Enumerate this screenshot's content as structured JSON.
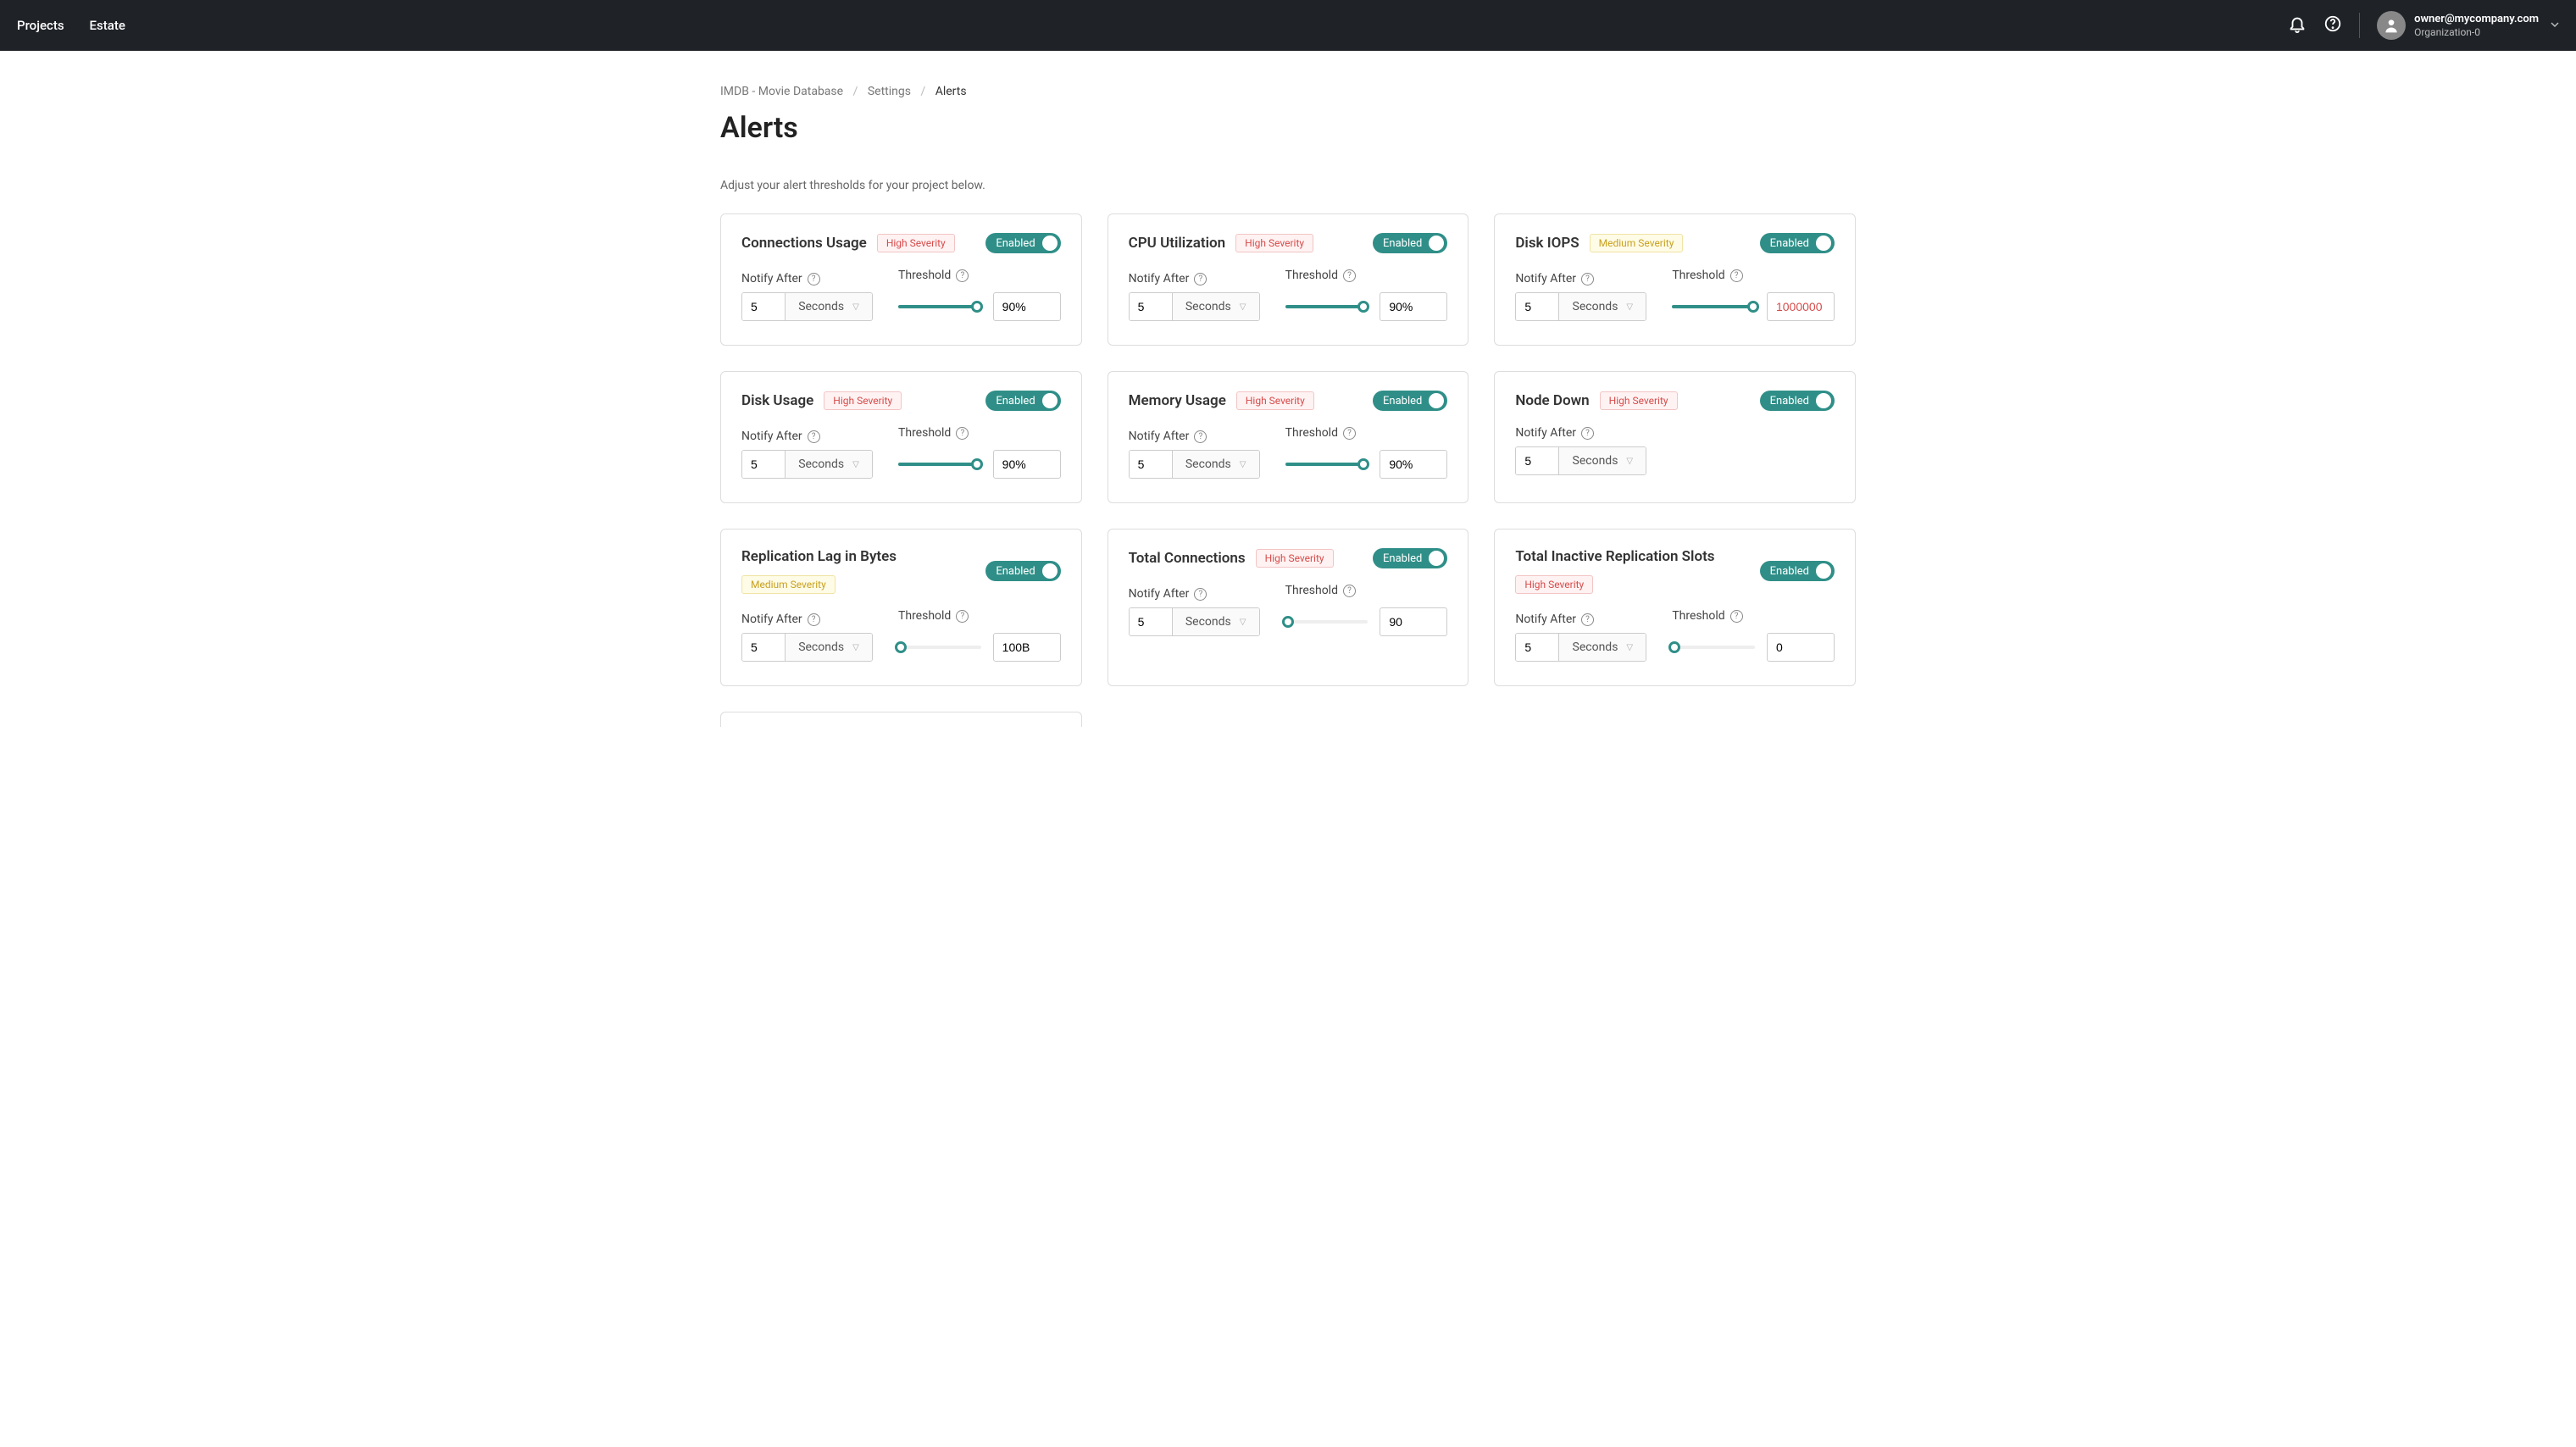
{
  "topbar": {
    "projects_label": "Projects",
    "estate_label": "Estate",
    "account_email": "owner@mycompany.com",
    "account_org": "Organization-0"
  },
  "breadcrumbs": {
    "item0": "IMDB - Movie Database",
    "item1": "Settings",
    "item2": "Alerts"
  },
  "page": {
    "title": "Alerts",
    "description": "Adjust your alert thresholds for your project below."
  },
  "labels": {
    "notify_after": "Notify After",
    "threshold": "Threshold",
    "enabled": "Enabled",
    "seconds_unit": "Seconds"
  },
  "severity": {
    "high": "High Severity",
    "medium": "Medium Severity"
  },
  "cards": [
    {
      "title": "Connections Usage",
      "severity": "high",
      "enabled": true,
      "notify_value": "5",
      "notify_unit": "Seconds",
      "has_threshold": true,
      "slider_percent": 95,
      "threshold_value": "90%",
      "threshold_error": false
    },
    {
      "title": "CPU Utilization",
      "severity": "high",
      "enabled": true,
      "notify_value": "5",
      "notify_unit": "Seconds",
      "has_threshold": true,
      "slider_percent": 95,
      "threshold_value": "90%",
      "threshold_error": false
    },
    {
      "title": "Disk IOPS",
      "severity": "medium",
      "enabled": true,
      "notify_value": "5",
      "notify_unit": "Seconds",
      "has_threshold": true,
      "slider_percent": 98,
      "threshold_value": "1000000",
      "threshold_error": true
    },
    {
      "title": "Disk Usage",
      "severity": "high",
      "enabled": true,
      "notify_value": "5",
      "notify_unit": "Seconds",
      "has_threshold": true,
      "slider_percent": 95,
      "threshold_value": "90%",
      "threshold_error": false
    },
    {
      "title": "Memory Usage",
      "severity": "high",
      "enabled": true,
      "notify_value": "5",
      "notify_unit": "Seconds",
      "has_threshold": true,
      "slider_percent": 95,
      "threshold_value": "90%",
      "threshold_error": false
    },
    {
      "title": "Node Down",
      "severity": "high",
      "enabled": true,
      "notify_value": "5",
      "notify_unit": "Seconds",
      "has_threshold": false
    },
    {
      "title": "Replication Lag in Bytes",
      "severity": "medium",
      "enabled": true,
      "notify_value": "5",
      "notify_unit": "Seconds",
      "has_threshold": true,
      "slider_percent": 3,
      "threshold_value": "100B",
      "threshold_error": false
    },
    {
      "title": "Total Connections",
      "severity": "high",
      "enabled": true,
      "notify_value": "5",
      "notify_unit": "Seconds",
      "has_threshold": true,
      "slider_percent": 3,
      "threshold_value": "90",
      "threshold_error": false
    },
    {
      "title": "Total Inactive Replication Slots",
      "severity": "high",
      "enabled": true,
      "notify_value": "5",
      "notify_unit": "Seconds",
      "has_threshold": true,
      "slider_percent": 3,
      "threshold_value": "0",
      "threshold_error": false
    }
  ]
}
